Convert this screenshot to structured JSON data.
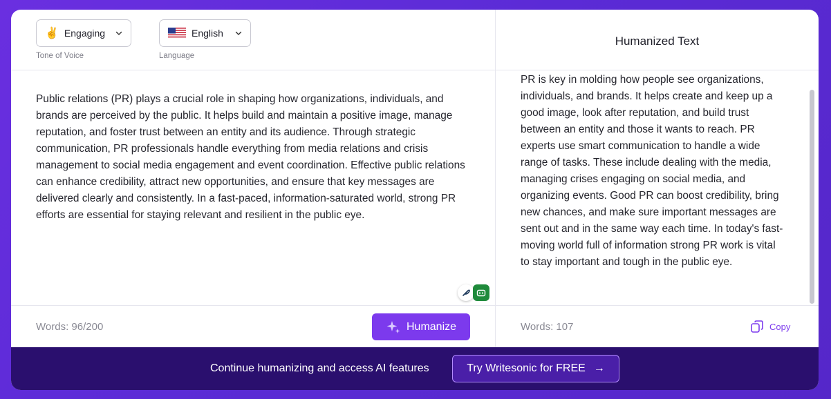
{
  "controls": {
    "tone": {
      "emoji": "✌️",
      "label": "Engaging",
      "caption": "Tone of Voice"
    },
    "language": {
      "label": "English",
      "caption": "Language"
    }
  },
  "input": {
    "text": "Public relations (PR) plays a crucial role in shaping how organizations, individuals, and brands are perceived by the public. It helps build and maintain a positive image, manage reputation, and foster trust between an entity and its audience. Through strategic communication, PR professionals handle everything from media relations and crisis management to social media engagement and event coordination. Effective public relations can enhance credibility, attract new opportunities, and ensure that key messages are delivered clearly and consistently. In a fast-paced, information-saturated world, strong PR efforts are essential for staying relevant and resilient in the public eye.",
    "word_count": "Words: 96/200"
  },
  "actions": {
    "humanize_label": "Humanize",
    "copy_label": "Copy"
  },
  "output": {
    "title": "Humanized Text",
    "text": "PR is key in molding how people see organizations, individuals, and brands. It helps create and keep up a good image, look after reputation, and build trust between an entity and those it wants to reach. PR experts use smart communication to handle a wide range of tasks. These include dealing with the media, managing crises engaging on social media, and organizing events. Good PR can boost credibility, bring new chances, and make sure important messages are sent out and in the same way each time. In today's fast-moving world full of information strong PR work is vital to stay important and tough in the public eye.",
    "word_count": "Words: 107"
  },
  "banner": {
    "text": "Continue humanizing and access AI features",
    "cta_label": "Try Writesonic for FREE",
    "cta_arrow": "→"
  },
  "colors": {
    "accent": "#7c3aed",
    "banner_bg": "#2a0f6e",
    "page_bg": "#5b2bd6"
  }
}
